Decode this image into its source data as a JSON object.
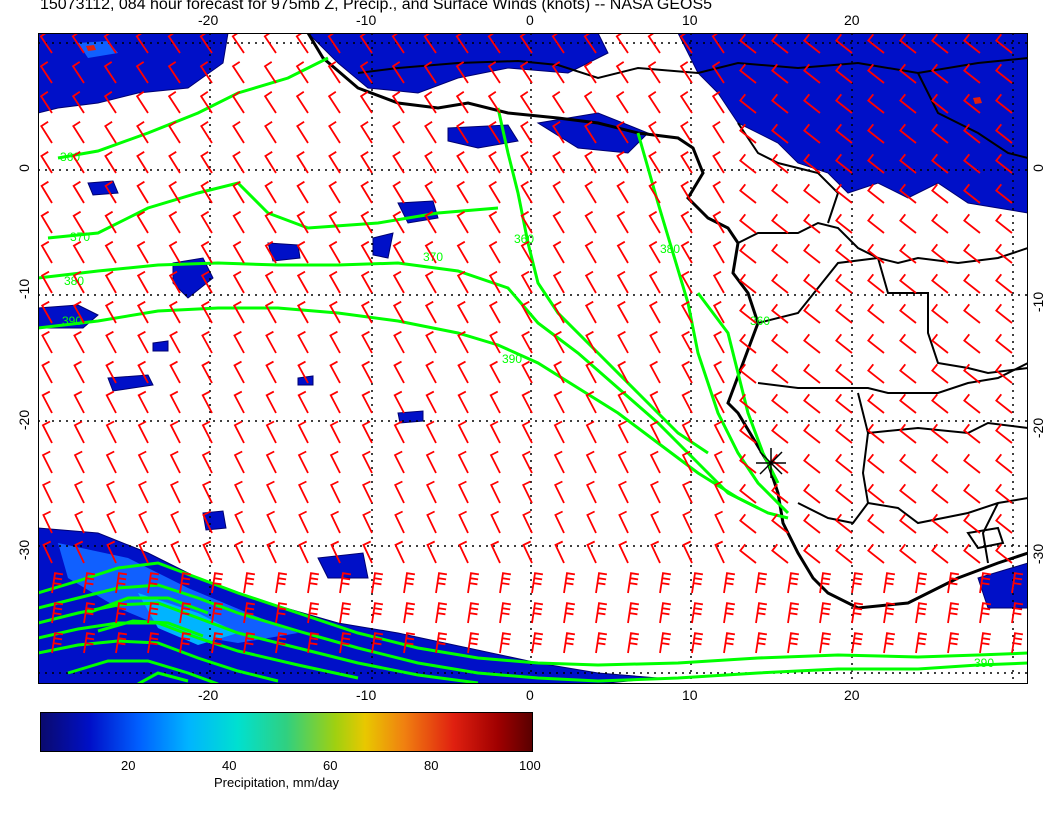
{
  "title": "15073112, 084 hour forecast for 975mb Z, Precip., and Surface Winds (knots) -- NASA GEOS5",
  "x_ticks": [
    "-20",
    "-10",
    "0",
    "10",
    "20"
  ],
  "y_ticks": [
    "0",
    "-10",
    "-20",
    "-30"
  ],
  "contour_labels": [
    "360",
    "370",
    "380",
    "390",
    "360",
    "370",
    "380",
    "390",
    "360",
    "390"
  ],
  "station_marker": "station-star",
  "colorbar": {
    "ticks": [
      "20",
      "40",
      "60",
      "80",
      "100"
    ],
    "label": "Precipitation, mm/day",
    "colors": [
      "#0a0a6e",
      "#0010c8",
      "#0060ff",
      "#00b4ff",
      "#00e0d0",
      "#30d080",
      "#a0d010",
      "#e8c800",
      "#f08010",
      "#e02010",
      "#a00000"
    ]
  },
  "colors": {
    "contour": "#00ff00",
    "wind_barb": "#ff0000",
    "coast": "#000000",
    "precip_light": "#0010c8",
    "precip_dark": "#000070"
  }
}
